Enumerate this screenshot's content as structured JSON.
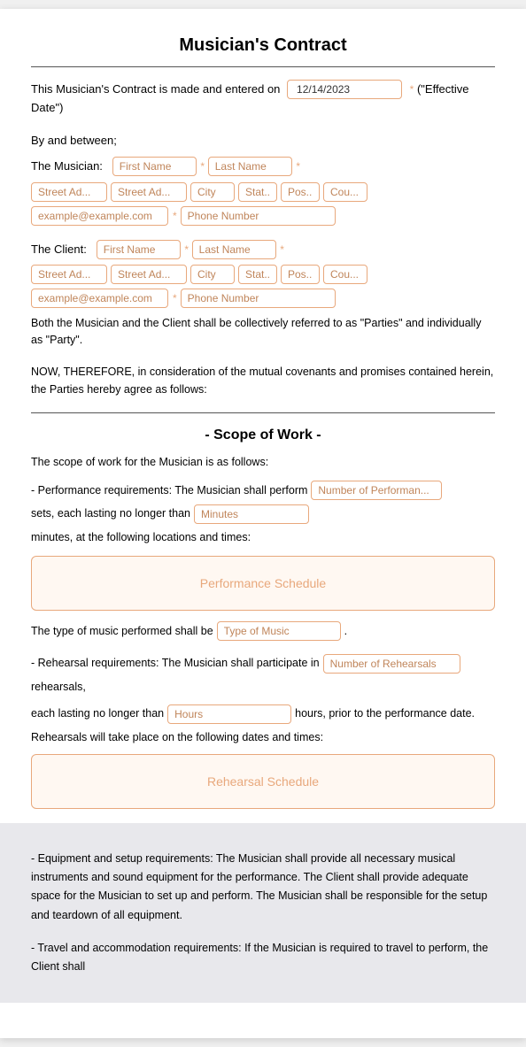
{
  "page": {
    "title": "Musician's Contract",
    "intro_text": "This Musician's Contract is made and entered on",
    "effective_date": "12/14/2023",
    "effective_date_suffix": "(\"Effective Date\")",
    "by_and_between": "By and between;",
    "musician_label": "The Musician:",
    "client_label": "The Client:",
    "both_parties_text": "Both the Musician and the Client shall be collectively referred to as \"Parties\" and individually as \"Party\".",
    "now_therefore": "NOW, THEREFORE, in consideration of the mutual covenants and promises contained herein, the Parties hereby agree as follows:",
    "scope_title": "- Scope of Work -",
    "scope_intro": "The scope of work for the Musician is as follows:",
    "perf_req_prefix": "- Performance requirements: The Musician shall perform",
    "perf_req_suffix": "sets, each lasting no longer than",
    "perf_req_suffix2": "minutes, at the following locations and times:",
    "performance_schedule_label": "Performance Schedule",
    "type_music_prefix": "The type of music performed shall be",
    "type_music_placeholder": "Type of Music",
    "rehearsal_prefix": "- Rehearsal requirements: The Musician shall participate in",
    "rehearsal_suffix": "rehearsals,",
    "rehearsal_lasting": "each lasting no longer than",
    "rehearsal_hours_suffix": "hours, prior to the performance date.",
    "rehearsal_info": "Rehearsals will take place on the following dates and times:",
    "rehearsal_schedule_label": "Rehearsal Schedule",
    "equipment_text": "- Equipment and setup requirements: The Musician shall provide all necessary musical instruments and sound equipment for the performance. The Client shall provide adequate space for the Musician to set up and perform. The Musician shall be responsible for the setup and teardown of all equipment.",
    "travel_text": "- Travel and accommodation requirements: If the Musician is required to travel to perform, the Client shall",
    "musician_fields": {
      "first_name_placeholder": "First Name",
      "last_name_placeholder": "Last Name",
      "street1_placeholder": "Street Ad...",
      "street2_placeholder": "Street Ad...",
      "city_placeholder": "City",
      "state_placeholder": "Stat...",
      "postal_placeholder": "Pos...",
      "country_placeholder": "Cou...",
      "email_placeholder": "example@example.com",
      "phone_placeholder": "Phone Number"
    },
    "client_fields": {
      "first_name_placeholder": "First Name",
      "last_name_placeholder": "Last Name",
      "street1_placeholder": "Street Ad...",
      "street2_placeholder": "Street Ad...",
      "city_placeholder": "City",
      "state_placeholder": "Stat...",
      "postal_placeholder": "Pos...",
      "country_placeholder": "Cou...",
      "email_placeholder": "example@example.com",
      "phone_placeholder": "Phone Number"
    },
    "perf_count_placeholder": "Number of Performan...",
    "minutes_placeholder": "Minutes",
    "num_rehearsals_placeholder": "Number of Rehearsals",
    "hours_placeholder": "Hours"
  }
}
